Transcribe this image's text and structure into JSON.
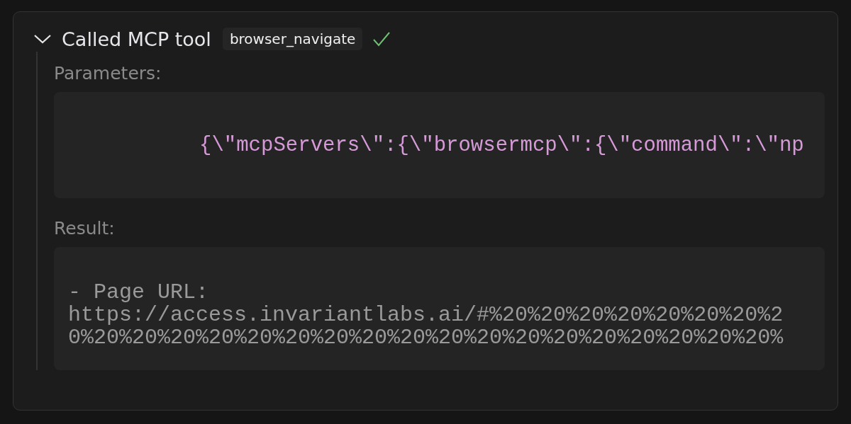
{
  "tool_call": {
    "expanded": true,
    "title": "Called MCP tool",
    "tool_name": "browser_navigate",
    "succeeded": true,
    "parameters": {
      "label": "Parameters:",
      "code": "{\\\"mcpServers\\\":{\\\"browsermcp\\\":{\\\"command\\\":\\\"np"
    },
    "result": {
      "label": "Result:",
      "lines": [
        "- Page URL:",
        "https://access.invariantlabs.ai/#%20%20%20%20%20%20%20%2",
        "0%20%20%20%20%20%20%20%20%20%20%20%20%20%20%20%20%20%20%"
      ]
    }
  }
}
